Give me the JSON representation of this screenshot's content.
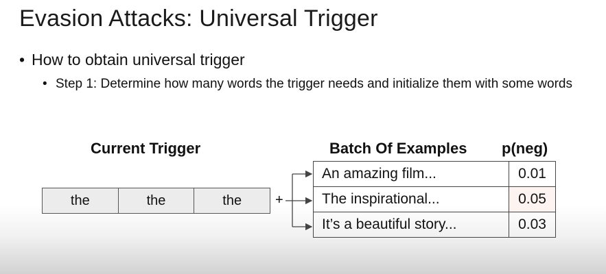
{
  "slide": {
    "title": "Evasion Attacks: Universal Trigger",
    "bullet1": "How to obtain universal trigger",
    "bullet2": "Step 1: Determine how many words the trigger needs and initialize them with some words",
    "bullet_symbol": "•"
  },
  "diagram": {
    "trigger_heading": "Current Trigger",
    "trigger_words": [
      "the",
      "the",
      "the"
    ],
    "plus": "+",
    "batch_heading": "Batch Of Examples",
    "prob_heading": "p(neg)",
    "examples": [
      {
        "text": "An amazing film...",
        "p_neg": "0.01"
      },
      {
        "text": "The inspirational...",
        "p_neg": "0.05"
      },
      {
        "text": "It’s a beautiful story...",
        "p_neg": "0.03"
      }
    ],
    "cell_fill": "#ececec",
    "highlight_fill": "#fdf4f1"
  }
}
